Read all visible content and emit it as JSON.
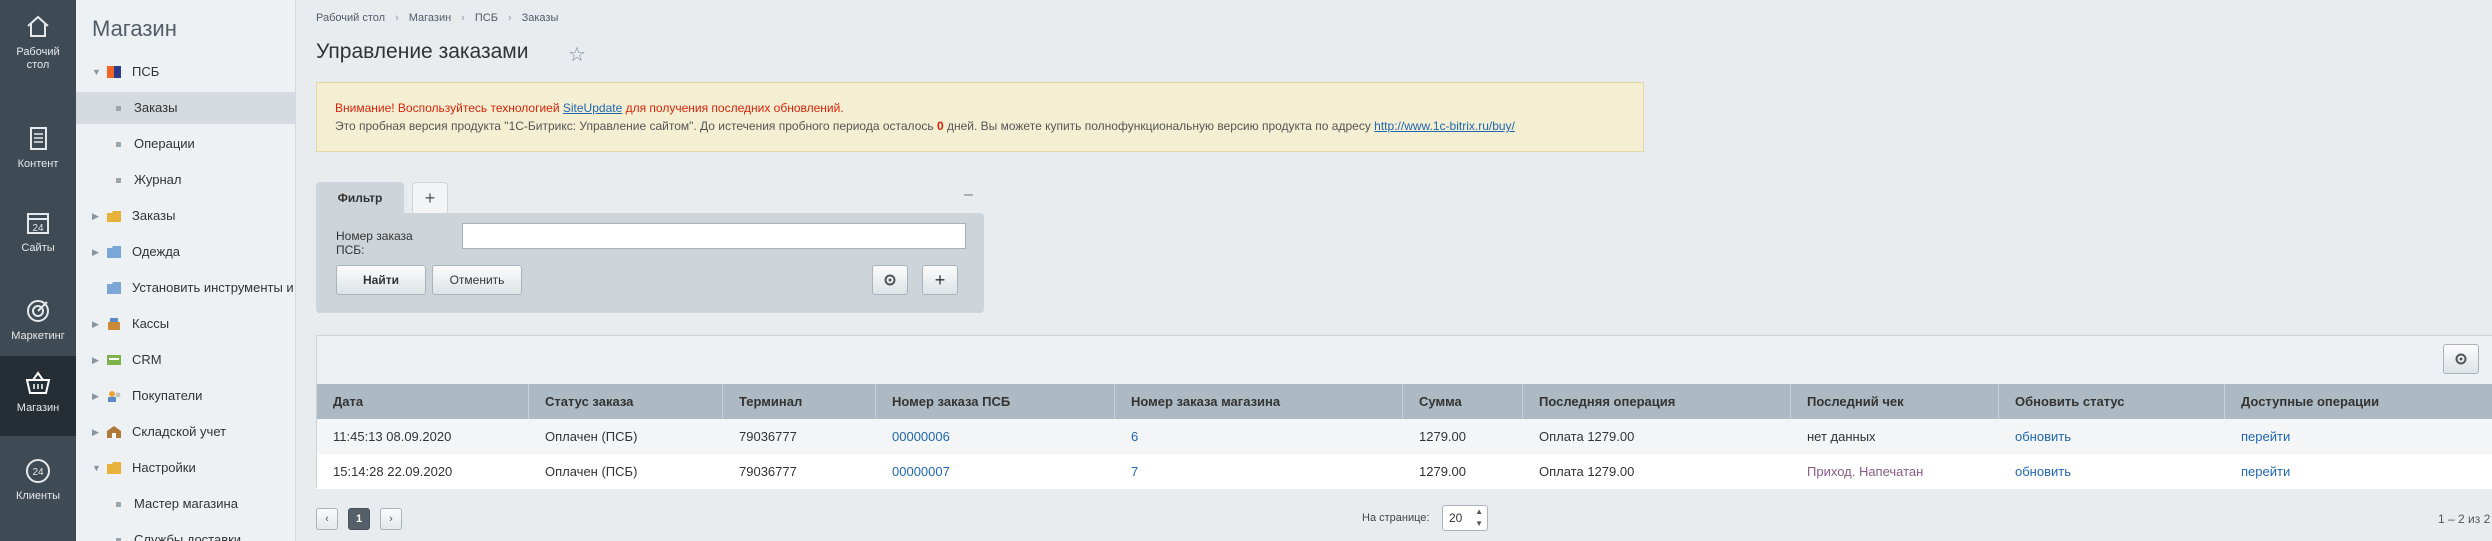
{
  "leftbar": {
    "items": [
      {
        "label": "Рабочий\nстол",
        "icon": "desktop-icon"
      },
      {
        "label": "Контент",
        "icon": "content-icon"
      },
      {
        "label": "Сайты",
        "icon": "calendar-24-icon"
      },
      {
        "label": "Маркетинг",
        "icon": "target-icon"
      },
      {
        "label": "Магазин",
        "icon": "basket-icon"
      },
      {
        "label": "Клиенты",
        "icon": "clients-24-icon"
      }
    ]
  },
  "menu": {
    "title": "Магазин",
    "items": [
      {
        "label": "ПСБ"
      },
      {
        "label": "Заказы"
      },
      {
        "label": "Операции"
      },
      {
        "label": "Журнал"
      },
      {
        "label": "Заказы"
      },
      {
        "label": "Одежда"
      },
      {
        "label": "Установить инструменты и"
      },
      {
        "label": "Кассы"
      },
      {
        "label": "CRM"
      },
      {
        "label": "Покупатели"
      },
      {
        "label": "Складской учет"
      },
      {
        "label": "Настройки"
      },
      {
        "label": "Мастер магазина"
      },
      {
        "label": "Службы доставки"
      }
    ]
  },
  "breadcrumbs": [
    "Рабочий стол",
    "Магазин",
    "ПСБ",
    "Заказы"
  ],
  "page_title": "Управление заказами",
  "notice": {
    "line1_a": "Внимание! Воспользуйтесь технологией ",
    "line1_link": "SiteUpdate",
    "line1_b": " для получения последних обновлений.",
    "line2_a": "Это пробная версия продукта \"1С-Битрикс: Управление сайтом\". До истечения пробного периода осталось ",
    "line2_days": "0",
    "line2_b": " дней. Вы можете купить полнофункциональную версию продукта по адресу ",
    "line2_link": "http://www.1c-bitrix.ru/buy/"
  },
  "filter": {
    "tab_label": "Фильтр",
    "add_tab": "+",
    "minimize": "–",
    "field_label": "Номер заказа ПСБ:",
    "field_value": "",
    "find_label": "Найти",
    "cancel_label": "Отменить",
    "plus_label": "+"
  },
  "grid": {
    "columns": [
      "Дата",
      "Статус заказа",
      "Терминал",
      "Номер заказа ПСБ",
      "Номер заказа магазина",
      "Сумма",
      "Последняя операция",
      "Последний чек",
      "Обновить статус",
      "Доступные операции"
    ],
    "rows": [
      [
        "11:45:13 08.09.2020",
        "Оплачен (ПСБ)",
        "79036777",
        "00000006",
        "6",
        "1279.00",
        "Оплата 1279.00",
        "нет данных",
        "обновить",
        "перейти"
      ],
      [
        "15:14:28 22.09.2020",
        "Оплачен (ПСБ)",
        "79036777",
        "00000007",
        "7",
        "1279.00",
        "Оплата 1279.00",
        "Приход. Напечатан",
        "обновить",
        "перейти"
      ]
    ]
  },
  "pagination": {
    "prev": "‹",
    "current": "1",
    "next": "›",
    "per_page_label": "На странице:",
    "per_page_value": "20",
    "info": "1 – 2 из 2"
  },
  "colors": {
    "leftbar_bg": "#3f4b54",
    "active_item_bg": "#252e35",
    "link": "#2067b0",
    "warning": "#d6240b",
    "table_header": "#adbac3"
  }
}
